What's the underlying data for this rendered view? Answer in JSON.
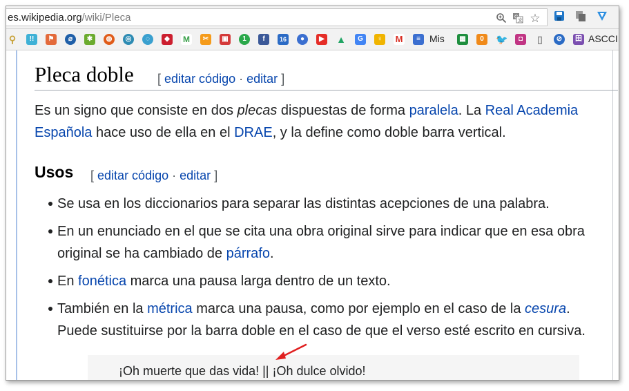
{
  "browser": {
    "url_domain": "es.wikipedia.org",
    "url_path": "/wiki/Pleca",
    "icons": [
      "zoom-icon",
      "translate-icon",
      "star-icon",
      "save-extension-icon",
      "copy-extension-icon",
      "vpn-extension-icon"
    ]
  },
  "bookmarks": {
    "mis_label": "Mis",
    "ascii_label": "ASCCI",
    "items": [
      {
        "name": "pin-bookmark",
        "glyph": "╀",
        "color": "#c8a23a"
      },
      {
        "name": "chat-bookmark",
        "glyph": "!!",
        "color": "#3fb1d6"
      },
      {
        "name": "flag-bookmark",
        "glyph": "⚑",
        "color": "#e36a3b"
      },
      {
        "name": "compass-bookmark",
        "glyph": "⌀",
        "color": "#1f5fa8"
      },
      {
        "name": "android-bookmark",
        "glyph": "✱",
        "color": "#6bab2e"
      },
      {
        "name": "orange-bookmark",
        "glyph": "◍",
        "color": "#e05c1a"
      },
      {
        "name": "ubuntu-bookmark",
        "glyph": "◉",
        "color": "#e95420"
      },
      {
        "name": "globe-bookmark",
        "glyph": "◎",
        "color": "#2d8bb3"
      },
      {
        "name": "spiral-bookmark",
        "glyph": "◌",
        "color": "#3aa0cf"
      },
      {
        "name": "ruby-bookmark",
        "glyph": "◆",
        "color": "#cc1f2f"
      },
      {
        "name": "mega-bookmark",
        "glyph": "M",
        "color": "#5aa43c"
      },
      {
        "name": "scissors-bookmark",
        "glyph": "✂",
        "color": "#f59b1b"
      },
      {
        "name": "presentation-bookmark",
        "glyph": "▣",
        "color": "#d43a3a"
      },
      {
        "name": "one-bookmark",
        "glyph": "1",
        "color": "#2aa84a"
      },
      {
        "name": "facebook-bookmark",
        "glyph": "f",
        "color": "#3b5998"
      },
      {
        "name": "calendar-bookmark",
        "glyph": "16",
        "color": "#2b6bc5"
      },
      {
        "name": "person-bookmark",
        "glyph": "●",
        "color": "#3b6fd0"
      },
      {
        "name": "youtube-bookmark",
        "glyph": "▶",
        "color": "#e52d27"
      },
      {
        "name": "drive-bookmark",
        "glyph": "▲",
        "color": "#1fa463"
      },
      {
        "name": "translate-bookmark",
        "glyph": "G",
        "color": "#4285f4"
      },
      {
        "name": "bulb-bookmark",
        "glyph": "♀",
        "color": "#f0b400"
      },
      {
        "name": "gmail-bookmark",
        "glyph": "M",
        "color": "#d93025"
      },
      {
        "name": "forms-bookmark",
        "glyph": "≡",
        "color": "#3b6fd0"
      },
      {
        "name": "sheets-bookmark",
        "glyph": "▦",
        "color": "#1e8e3e"
      },
      {
        "name": "zero-bookmark",
        "glyph": "0",
        "color": "#f08a1a"
      },
      {
        "name": "twitter-bookmark",
        "glyph": "t",
        "color": "#1da1f2"
      },
      {
        "name": "instagram-bookmark",
        "glyph": "◘",
        "color": "#c13584"
      },
      {
        "name": "file-bookmark",
        "glyph": "▯",
        "color": "#9e9e9e"
      },
      {
        "name": "slash-bookmark",
        "glyph": "⊘",
        "color": "#2b6bc5"
      },
      {
        "name": "ascii-bookmark",
        "glyph": "田",
        "color": "#7b4fb0"
      }
    ]
  },
  "article": {
    "title": "Pleca doble",
    "edit_open": "[",
    "edit_code": "editar código",
    "edit_sep": "·",
    "edit_edit": "editar",
    "edit_close": "]",
    "intro": {
      "l1_a": "Es un signo que consiste en dos ",
      "l1_b": "plecas",
      "l1_c": " dispuestas de forma ",
      "l1_link1": "paralela",
      "l1_d": ". La ",
      "l1_link2": "Real Academia",
      "l2_link2": "Española",
      "l2_a": " hace uso de ella en el ",
      "l2_link3": "DRAE",
      "l2_b": ", y la define como doble barra vertical."
    },
    "section_title": "Usos",
    "items": {
      "i1": "Se usa en los diccionarios para separar las distintas acepciones de una palabra.",
      "i2_l1": "En un enunciado en el que se cita una obra original sirve para indicar que en esa obra",
      "i2_l2_a": "original se ha cambiado de ",
      "i2_l2_link": "párrafo",
      "i2_l2_b": ".",
      "i3_a": "En ",
      "i3_link": "fonética",
      "i3_b": " marca una pausa larga dentro de un texto.",
      "i4_l1_a": "También en la ",
      "i4_l1_link": "métrica",
      "i4_l1_b": " marca una pausa, como por ejemplo en el caso de la ",
      "i4_l1_link2": "cesura",
      "i4_l1_c": ".",
      "i4_l2": "Puede sustituirse por la barra doble en el caso de que el verso esté escrito en cursiva."
    },
    "quote": "¡Oh muerte que das vida! || ¡Oh dulce olvido!"
  },
  "colors": {
    "link": "#0645ad",
    "arrow": "#e02020"
  }
}
